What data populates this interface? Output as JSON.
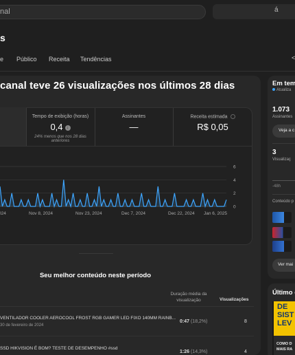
{
  "search": {
    "text": "nal",
    "right_glyph": "á"
  },
  "page": {
    "title": "s"
  },
  "tabs": [
    {
      "label": "e"
    },
    {
      "label": "Público"
    },
    {
      "label": "Receita"
    },
    {
      "label": "Tendências"
    }
  ],
  "right_edge_glyph": "<",
  "main": {
    "headline": "canal teve 26 visualizações nos últimos 28 dias",
    "metrics": [
      {
        "label": "Tempo de exibição (horas)",
        "value": "0,4",
        "sub": "24% menos que nos 28 dias anteriores",
        "icon": "arrow-down-icon"
      },
      {
        "label": "Assinantes",
        "value": "—"
      },
      {
        "label": "Receita estimada",
        "value": "R$ 0,05",
        "icon": "info-icon"
      }
    ],
    "section_title": "Seu melhor conteúdo neste período",
    "columns": {
      "duration": "Duração média da visualização",
      "views": "Visualizações"
    },
    "rows": [
      {
        "title": "VENTILADOR COOLER AEROCOOL FROST RGB GAMER LED FIXO 140MM RAINB...",
        "date": "30 de fevereiro de 2024",
        "duration": "0:47",
        "duration_pct": "(18,2%)",
        "views": "8"
      },
      {
        "title": "SSD HIKVISION É BOM? TESTE DE DESEMPENHO #ssd",
        "date": "",
        "duration": "1:26",
        "duration_pct": "(14,3%)",
        "views": "4"
      }
    ]
  },
  "chart_data": {
    "type": "area",
    "x_ticks": [
      "024",
      "Nov 8, 2024",
      "Nov 23, 2024",
      "Dec 7, 2024",
      "Dec 22, 2024",
      "Jan 6, 2025"
    ],
    "y_ticks": [
      "6",
      "4",
      "2",
      "0"
    ],
    "ylim": [
      0,
      6
    ],
    "grid": true,
    "color": "#3ea6ff",
    "values": [
      3,
      0,
      1,
      0,
      0,
      2,
      0,
      0,
      0,
      1,
      0,
      0,
      1,
      0,
      0,
      0,
      2,
      0,
      1,
      0,
      0,
      0,
      2,
      0,
      1,
      0,
      0,
      4,
      0,
      1,
      0,
      2,
      0,
      0,
      1,
      0,
      0,
      2,
      0,
      0,
      1,
      0,
      3,
      0,
      1,
      0,
      0,
      1,
      0,
      0,
      2,
      0,
      0,
      1,
      0,
      0,
      1,
      0,
      0,
      0,
      2,
      0,
      0,
      1,
      0,
      0,
      0,
      3,
      0,
      0,
      1,
      0,
      0,
      0,
      2,
      0,
      0,
      0,
      0,
      1,
      0,
      0,
      1,
      0,
      0,
      0,
      2,
      0,
      1,
      0,
      0,
      1,
      0,
      0,
      0,
      0,
      1
    ]
  },
  "side": {
    "title": "Em tem",
    "live": "Atualiza",
    "subs_value": "1.073",
    "subs_label": "Assinantes",
    "subs_button": "Veja a c",
    "views_value": "3",
    "views_label": "Visualizaç",
    "hours_label": "-48h",
    "content_label": "Conteúdo p",
    "more_button": "Ver mai",
    "latest_title": "Último c",
    "thumb_top": [
      "DE",
      "SIST",
      "LEV"
    ],
    "thumb_bottom": [
      "COMO D",
      "MAIS RA"
    ]
  }
}
